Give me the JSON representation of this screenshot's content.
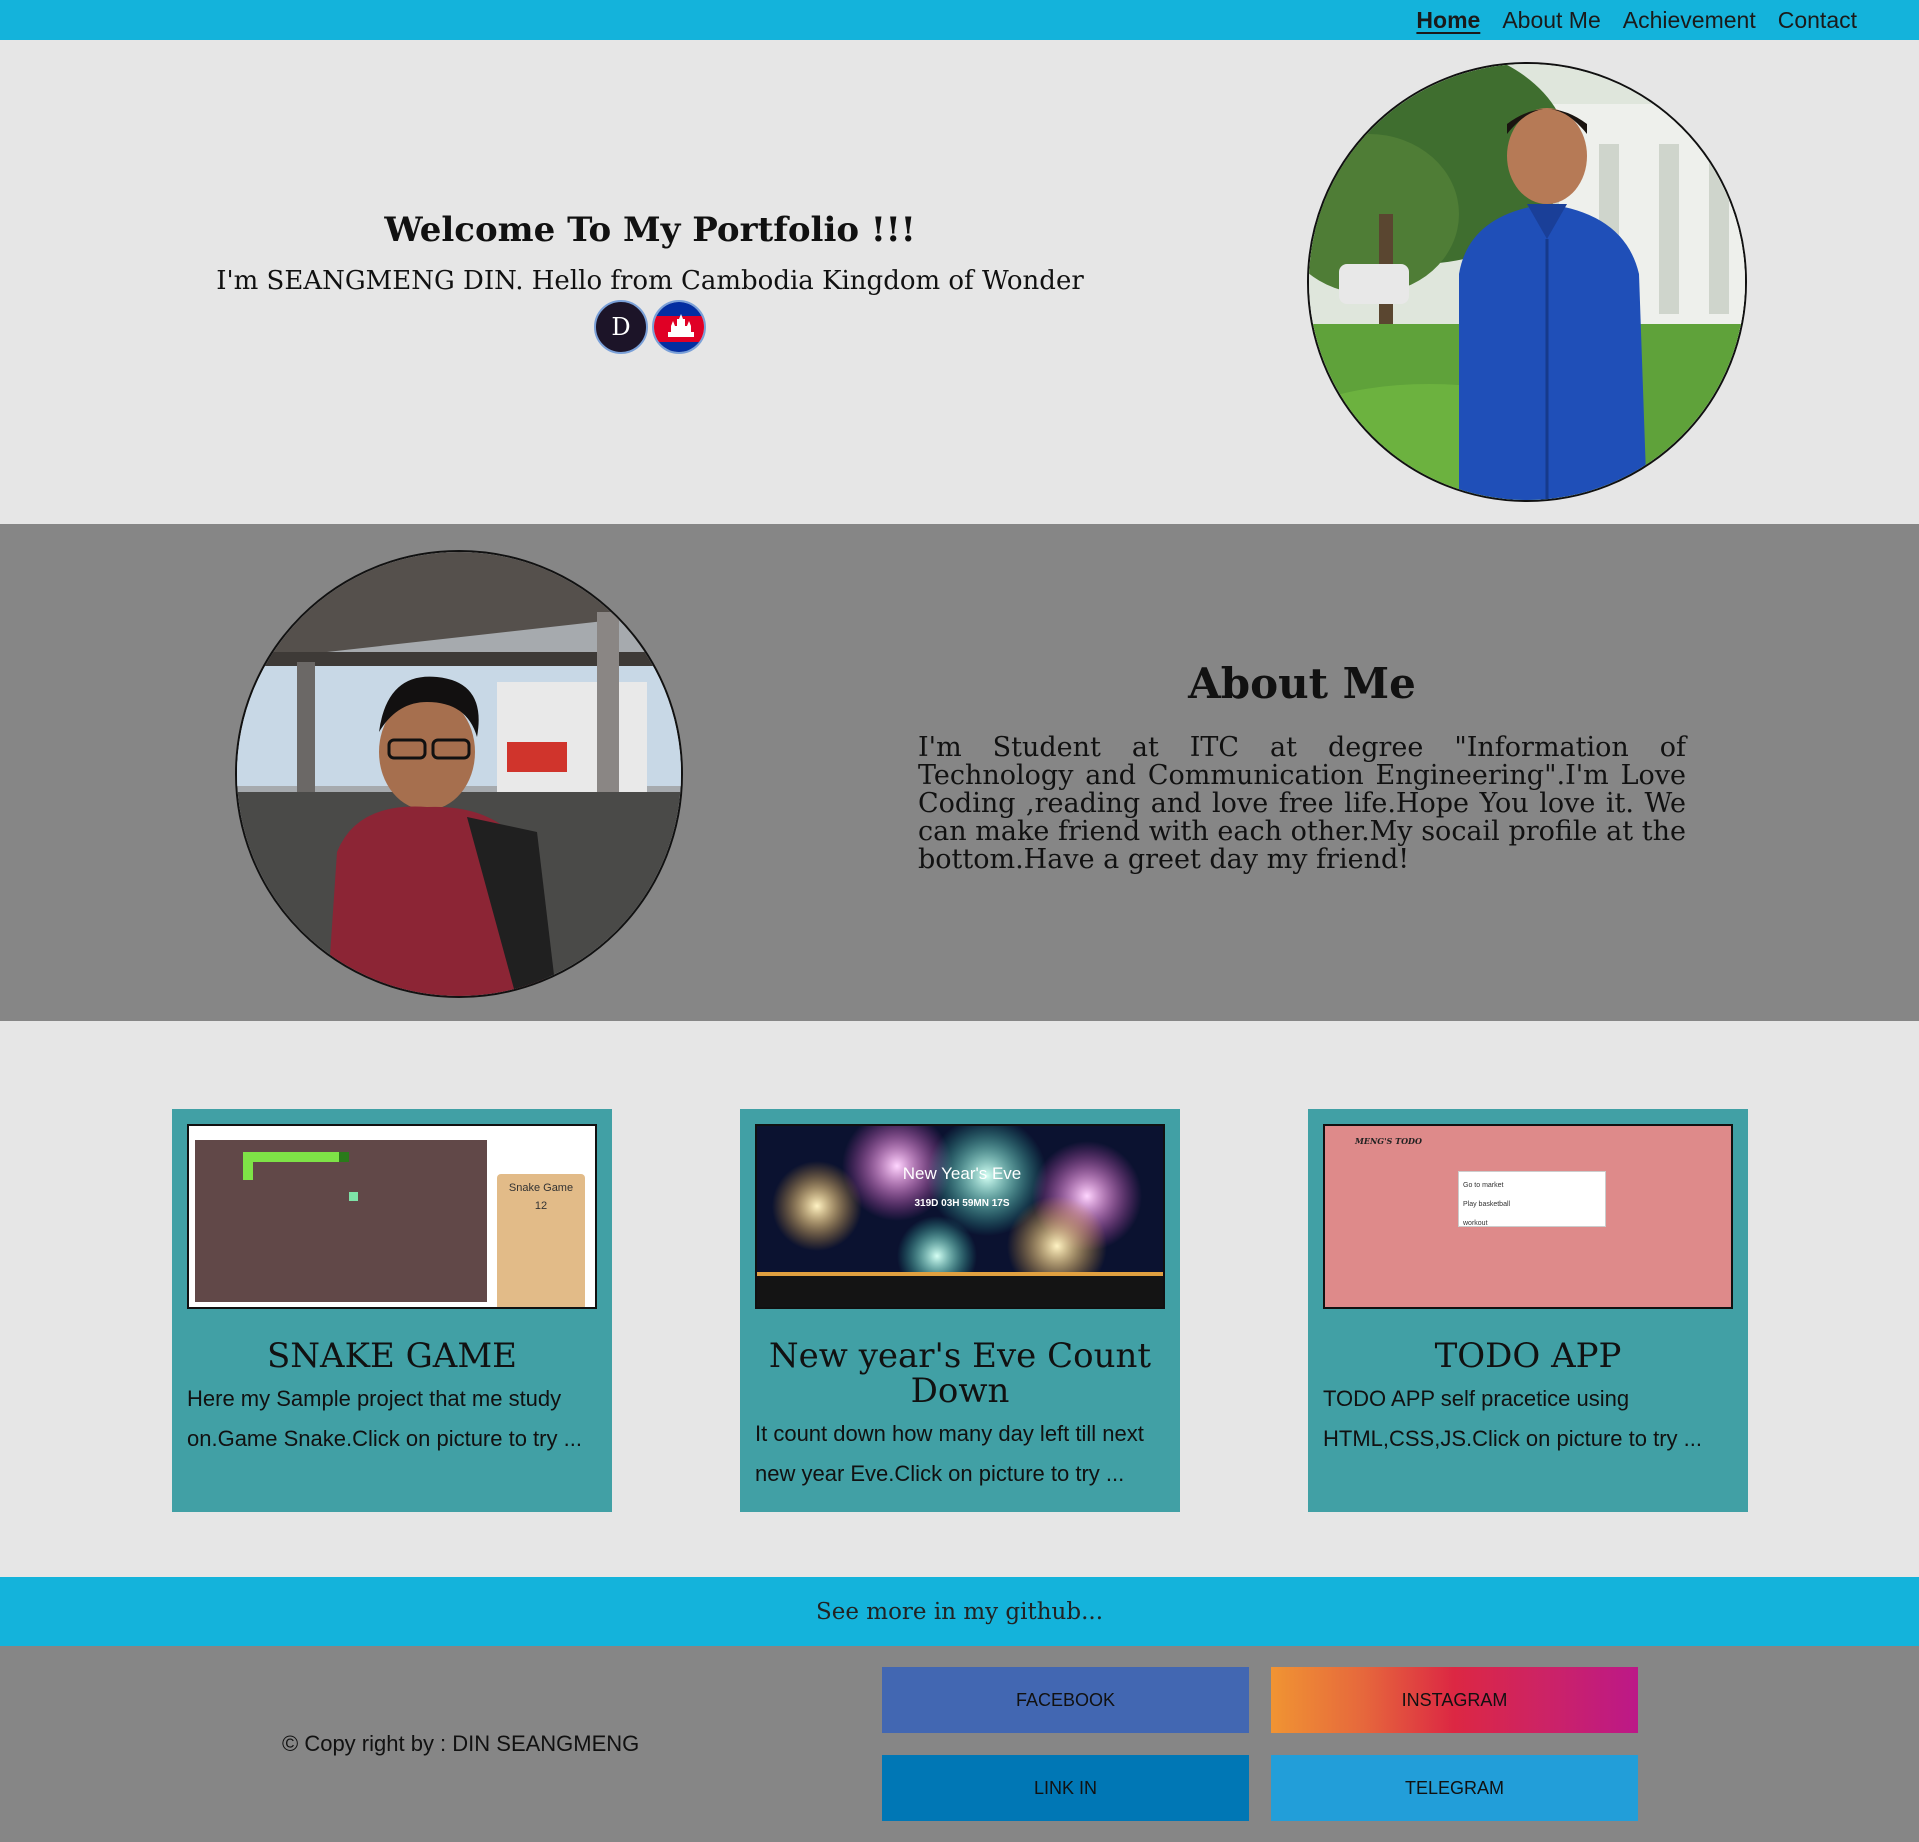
{
  "nav": {
    "links": [
      "Home",
      "About Me",
      "Achievement",
      "Contact"
    ],
    "active": "Home",
    "color": "#14b3db"
  },
  "hero": {
    "title": "Welcome To My Portfolio !!!",
    "subtitle": "I'm SEANGMENG DIN. Hello from Cambodia Kingdom of Wonder",
    "badge_letter": "D",
    "badge_flag_icon": "cambodia-flag-icon",
    "photo": "portrait-photo-blue-shirt"
  },
  "about": {
    "title": "About Me",
    "text": "I'm Student at ITC at degree \"Information of Technology and Communication Engineering\".I'm Love Coding ,reading and love free life.Hope You love it. We can make friend with each other.My socail profile at the bottom.Have a greet day my friend!",
    "photo": "portrait-photo-red-shirt"
  },
  "projects": [
    {
      "title": "SNAKE GAME",
      "desc": "Here my Sample project that me study on.Game Snake.Click on picture to try ...",
      "thumb_label": "Snake Game",
      "thumb_score": "12"
    },
    {
      "title": "New year's Eve Count Down",
      "desc": "It count down how many day left till next new year Eve.Click on picture to try ...",
      "thumb_label": "New Year's Eve",
      "thumb_timer": "319D 03H 59MN 17S"
    },
    {
      "title": "TODO APP",
      "desc": "TODO APP self pracetice using HTML,CSS,JS.Click on picture to try ...",
      "thumb_label": "MENG'S TODO",
      "thumb_items": [
        "Go to market",
        "Play basketball",
        "workout"
      ]
    }
  ],
  "github": {
    "text": "See more in my github..."
  },
  "footer": {
    "copyright": "© Copy right by : DIN SEANGMENG",
    "social": {
      "facebook": "FACEBOOK",
      "instagram": "INSTAGRAM",
      "linkedin": "LINK IN",
      "telegram": "TELEGRAM"
    },
    "colors": {
      "facebook": "#4267b2",
      "linkedin": "#0077b5",
      "telegram": "#229ed9"
    }
  }
}
